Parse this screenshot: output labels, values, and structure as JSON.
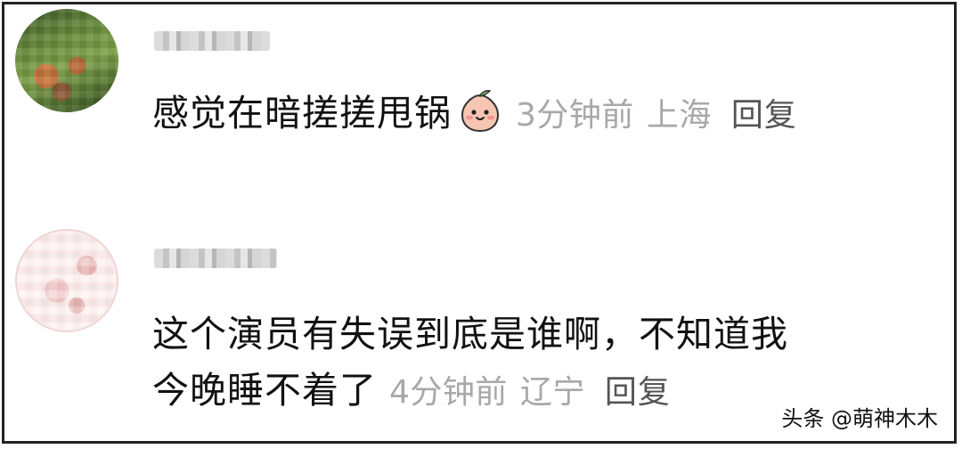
{
  "comments": [
    {
      "text": "感觉在暗搓搓甩锅",
      "emoji": "peach-smile-emoji",
      "time": "3分钟前",
      "location": "上海",
      "reply_label": "回复"
    },
    {
      "text_line1": "这个演员有失误到底是谁啊，不知道我",
      "text_line2": "今晚睡不着了",
      "time": "4分钟前",
      "location": "辽宁",
      "reply_label": "回复"
    }
  ],
  "watermark": "头条 @萌神木木"
}
